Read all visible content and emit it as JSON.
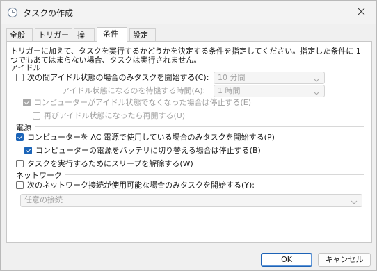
{
  "window": {
    "title": "タスクの作成"
  },
  "tabs": [
    {
      "label": "全般"
    },
    {
      "label": "トリガー"
    },
    {
      "label": "操作"
    },
    {
      "label": "条件"
    },
    {
      "label": "設定"
    }
  ],
  "description": "トリガーに加えて、タスクを実行するかどうかを決定する条件を指定してください。指定した条件に 1 つでもあてはまらない場合、タスクは実行されません。",
  "idle": {
    "group_label": "アイドル",
    "start_only_if_idle": {
      "label": "次の間アイドル状態の場合のみタスクを開始する(C):",
      "checked": false
    },
    "idle_duration": {
      "value": "10 分間"
    },
    "wait_label": "アイドル状態になるのを待機する時間(A):",
    "wait_duration": {
      "value": "1 時間"
    },
    "stop_if_not_idle": {
      "label": "コンピューターがアイドル状態でなくなった場合は停止する(E)",
      "checked": true
    },
    "restart_if_idle": {
      "label": "再びアイドル状態になったら再開する(U)",
      "checked": false
    }
  },
  "power": {
    "group_label": "電源",
    "ac_only": {
      "label": "コンピューターを AC 電源で使用している場合のみタスクを開始する(P)",
      "checked": true
    },
    "stop_on_battery": {
      "label": "コンピューターの電源をバッテリに切り替える場合は停止する(B)",
      "checked": true
    },
    "wake": {
      "label": "タスクを実行するためにスリープを解除する(W)",
      "checked": false
    }
  },
  "network": {
    "group_label": "ネットワーク",
    "network_only": {
      "label": "次のネットワーク接続が使用可能な場合のみタスクを開始する(Y):",
      "checked": false
    },
    "connection": {
      "value": "任意の接続"
    }
  },
  "buttons": {
    "ok": "OK",
    "cancel": "キャンセル"
  },
  "colors": {
    "accent": "#1b64b8",
    "disabled_text": "#a0a0a0"
  }
}
